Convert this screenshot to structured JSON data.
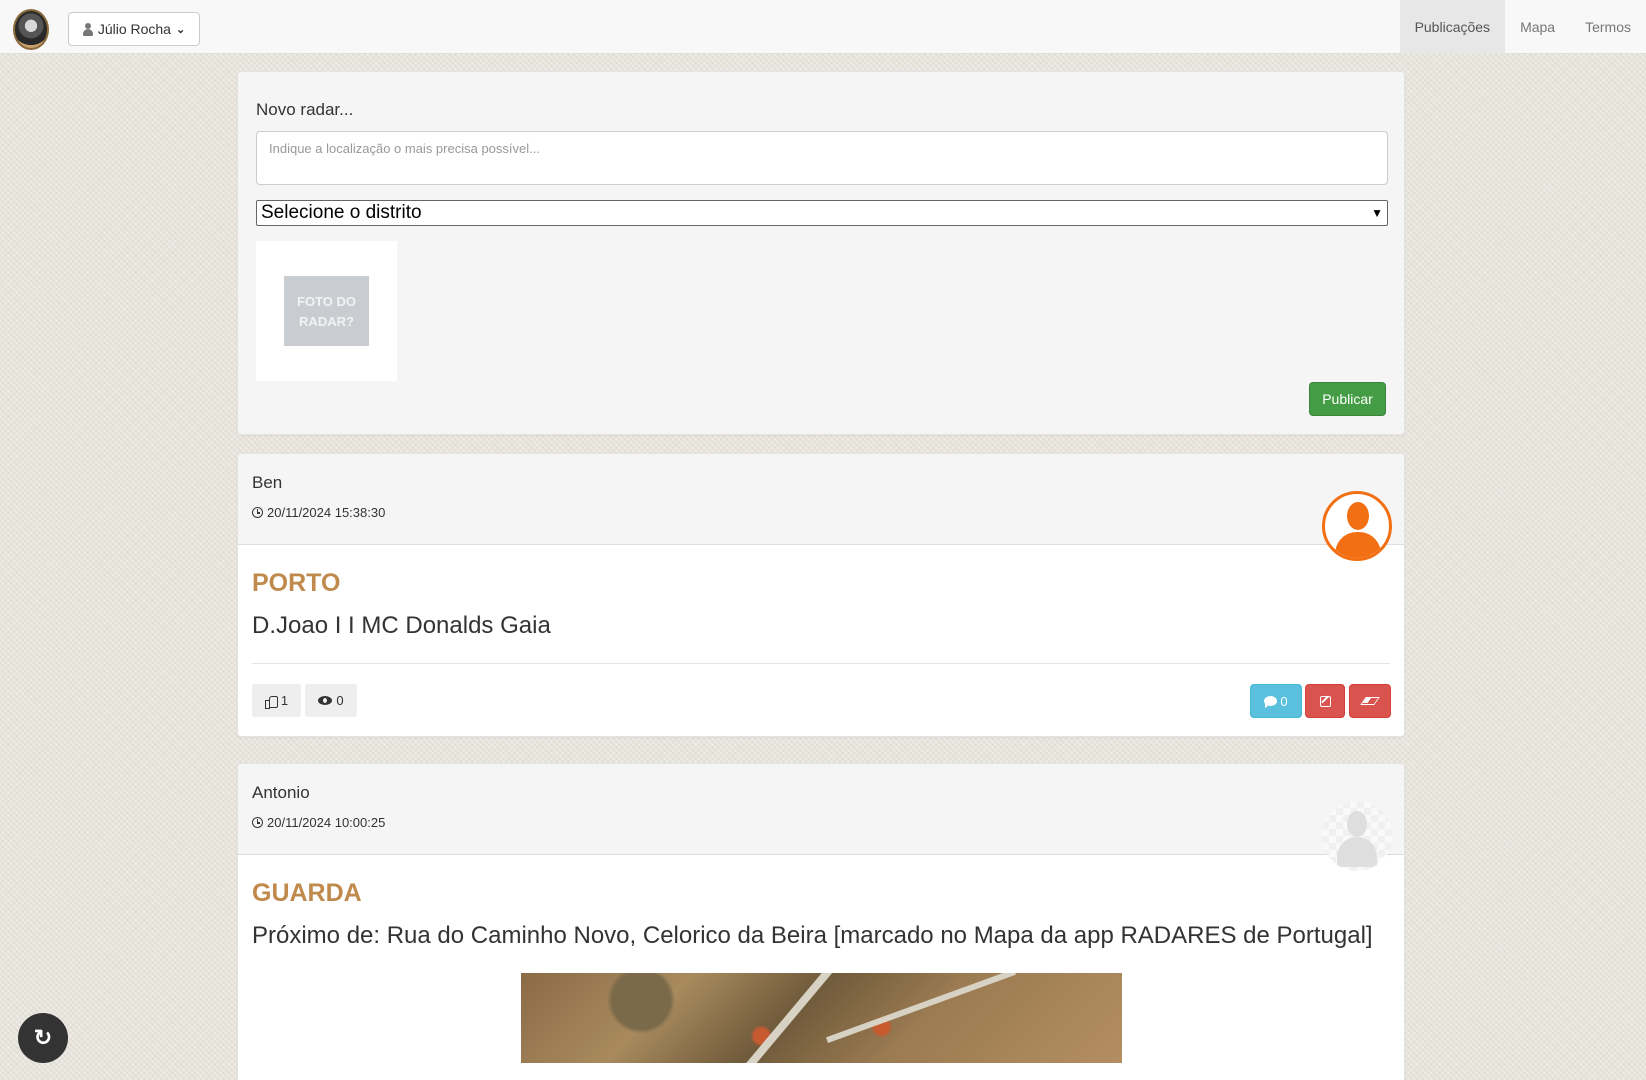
{
  "navbar": {
    "user_name": "Júlio Rocha",
    "links": [
      "Publicações",
      "Mapa",
      "Termos"
    ],
    "active_link": "Publicações"
  },
  "composer": {
    "label": "Novo radar...",
    "location_placeholder": "Indique a localização o mais precisa possível...",
    "district_select": "Selecione o distrito",
    "photo_placeholder": "FOTO DO RADAR?",
    "publish_label": "Publicar"
  },
  "posts": [
    {
      "author": "Ben",
      "timestamp": "20/11/2024 15:38:30",
      "district": "PORTO",
      "location": "D.Joao I I MC Donalds Gaia",
      "likes": "1",
      "views": "0",
      "comments": "0",
      "avatar": "orange-person-icon"
    },
    {
      "author": "Antonio",
      "timestamp": "20/11/2024 10:00:25",
      "district": "GUARDA",
      "location": "Próximo de: Rua do Caminho Novo, Celorico da Beira [marcado no Mapa da app RADARES de Portugal]",
      "avatar": "ghost-person-icon"
    }
  ],
  "colors": {
    "district": "#c08a4c",
    "publish": "#449d44",
    "comment": "#5bc0de",
    "danger": "#d9534f",
    "avatar_orange": "#f36f13"
  }
}
